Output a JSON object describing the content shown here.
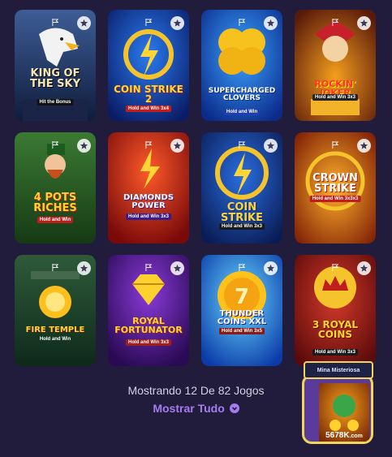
{
  "games": [
    {
      "title": "King of the Sky",
      "subtitle": "Hit the Bonus",
      "icon": "eagle"
    },
    {
      "title": "Coin Strike 2",
      "subtitle": "Hold and Win 3x4",
      "icon": "lightning-coin"
    },
    {
      "title": "Supercharged Clovers",
      "subtitle": "Hold and Win",
      "icon": "clover"
    },
    {
      "title": "Rockin' Joker",
      "subtitle": "Hold and Win 3x3",
      "icon": "joker"
    },
    {
      "title": "4 Pots Riches",
      "subtitle": "Hold and Win",
      "icon": "leprechaun"
    },
    {
      "title": "Diamonds Power",
      "subtitle": "Hold and Win 3x3",
      "icon": "diamond"
    },
    {
      "title": "Coin Strike",
      "subtitle": "Hold and Win 3x3",
      "icon": "lightning-coin"
    },
    {
      "title": "Crown Strike",
      "subtitle": "Hold and Win 3x3x3",
      "icon": "crown"
    },
    {
      "title": "Fire Temple",
      "subtitle": "Hold and Win",
      "icon": "fire-orb"
    },
    {
      "title": "Royal Fortunator",
      "subtitle": "Hold and Win 3x3",
      "icon": "diamond"
    },
    {
      "title": "Thunder Coins XXL",
      "subtitle": "Hold and Win 3x5",
      "icon": "coin"
    },
    {
      "title": "3 Royal Coins",
      "subtitle": "Hold and Win 3x3",
      "icon": "crown"
    }
  ],
  "footer": {
    "count_text": "Mostrando 12 De 82 Jogos",
    "show_all": "Mostrar Tudo"
  },
  "promo": {
    "label": "Mina Misteriosa",
    "domain": "5678K",
    "domain_suffix": ".com"
  },
  "colors": {
    "background": "#221c3c",
    "accent": "#a57cf0",
    "promo_border": "#f1d45a"
  }
}
